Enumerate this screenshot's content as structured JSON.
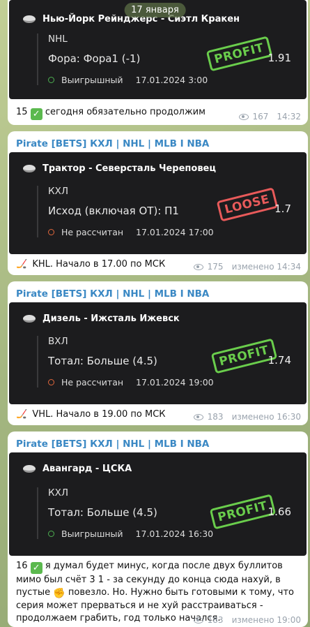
{
  "date_pill": "17 января",
  "messages": [
    {
      "card": {
        "match": "Нью-Йорк Рейнджерс - Сиэтл Кракен",
        "league": "NHL",
        "bet": "Фора: Фора1 (-1)",
        "status": "Выигрышный",
        "status_type": "win",
        "datetime": "17.01.2024 3:00",
        "odds": "1.91",
        "stamp": "PROFIT"
      },
      "caption_num": "15",
      "caption_text": "сегодня обязательно продолжим",
      "views": "167",
      "time": "14:32"
    },
    {
      "sender": "Pirate [BETS] КХЛ | NHL | MLB I NBA",
      "card": {
        "match": "Трактор - Северсталь Череповец",
        "league": "КХЛ",
        "bet": "Исход (включая ОТ): П1",
        "status": "Не рассчитан",
        "status_type": "pending",
        "datetime": "17.01.2024 17:00",
        "odds": "1.7",
        "stamp": "LOOSE"
      },
      "caption_text": "KHL. Начало в 17.00 по МСК",
      "views": "175",
      "time": "изменено 14:34"
    },
    {
      "sender": "Pirate [BETS] КХЛ | NHL | MLB I NBA",
      "card": {
        "match": "Дизель - Ижсталь Ижевск",
        "league": "ВХЛ",
        "bet": "Тотал: Больше (4.5)",
        "status": "Не рассчитан",
        "status_type": "pending",
        "datetime": "17.01.2024 19:00",
        "odds": "1.74",
        "stamp": "PROFIT"
      },
      "caption_text": "VHL. Начало в 19.00 по МСК",
      "views": "183",
      "time": "изменено 16:30"
    },
    {
      "sender": "Pirate [BETS] КХЛ | NHL | MLB I NBA",
      "card": {
        "match": "Авангард - ЦСКА",
        "league": "КХЛ",
        "bet": "Тотал: Больше (4.5)",
        "status": "Выигрышный",
        "status_type": "win",
        "datetime": "17.01.2024 16:30",
        "odds": "1.66",
        "stamp": "PROFIT"
      },
      "caption_num": "16",
      "caption_text_a": "я думал будет минус, когда после двух буллитов мимо был счёт 3 1 - за секунду до конца сюда нахуй, в пустые",
      "caption_text_b": "повезло. Но. Нужно быть готовыми к тому, что серия может прерваться и не хуй расстраиваться - продолжаем грабить, год только начался.",
      "views": "183",
      "time": "изменено 19:00"
    }
  ],
  "colors": {
    "profit": "#6acd4c",
    "loose": "#e85a5a",
    "sender": "#3a88c4"
  }
}
